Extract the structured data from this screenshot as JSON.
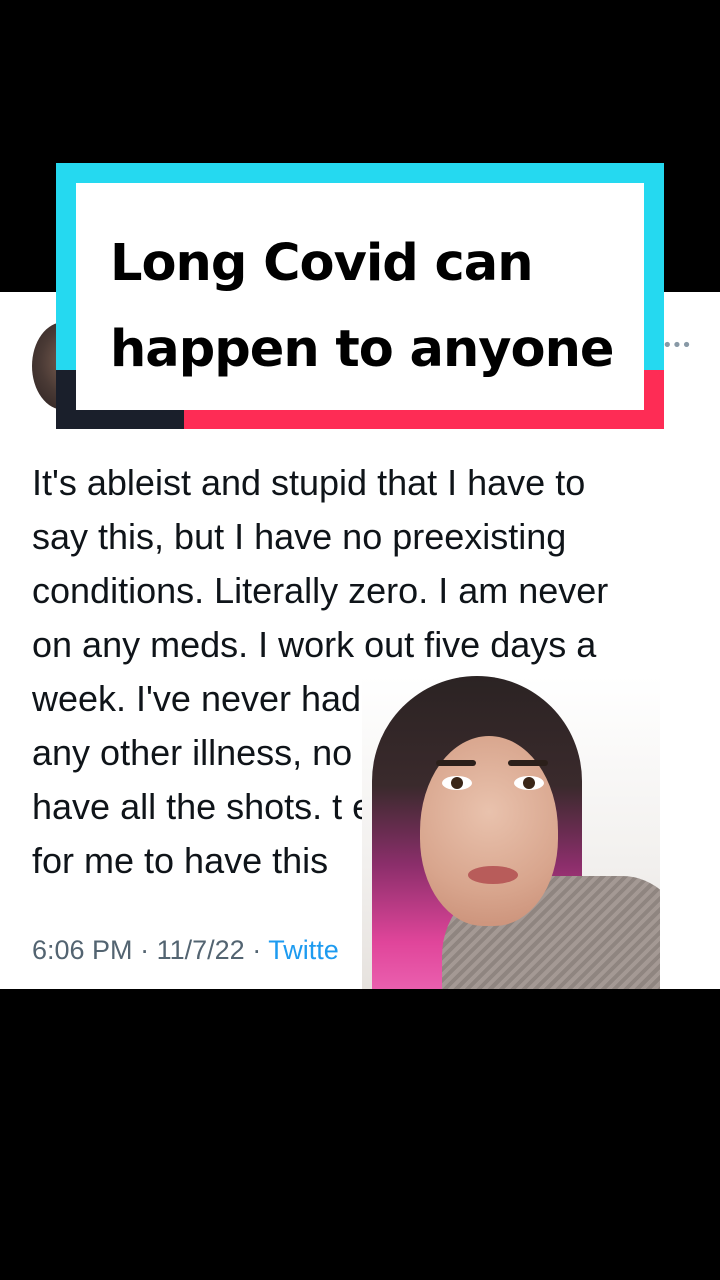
{
  "title": {
    "line1": "Long Covid can",
    "line2": "happen to anyone"
  },
  "tweet": {
    "more_icon": "more-horizontal-icon",
    "body": "It's ableist and stupid that I have to\nsay this, but I have no preexisting\nconditions. Literally zero. I am never\non any meds. I work out five days a\nweek. I've never had br      itis or\nany other illness, no            or. I\nhave all the shots. t          eason\nfor me to have this",
    "time": "6:06 PM",
    "separator": "·",
    "date": "11/7/22",
    "source": "Twitte"
  },
  "colors": {
    "accent_cyan": "#25d9f0",
    "accent_red": "#fe2c55",
    "link_blue": "#1d9bf0",
    "meta_gray": "#536471"
  }
}
